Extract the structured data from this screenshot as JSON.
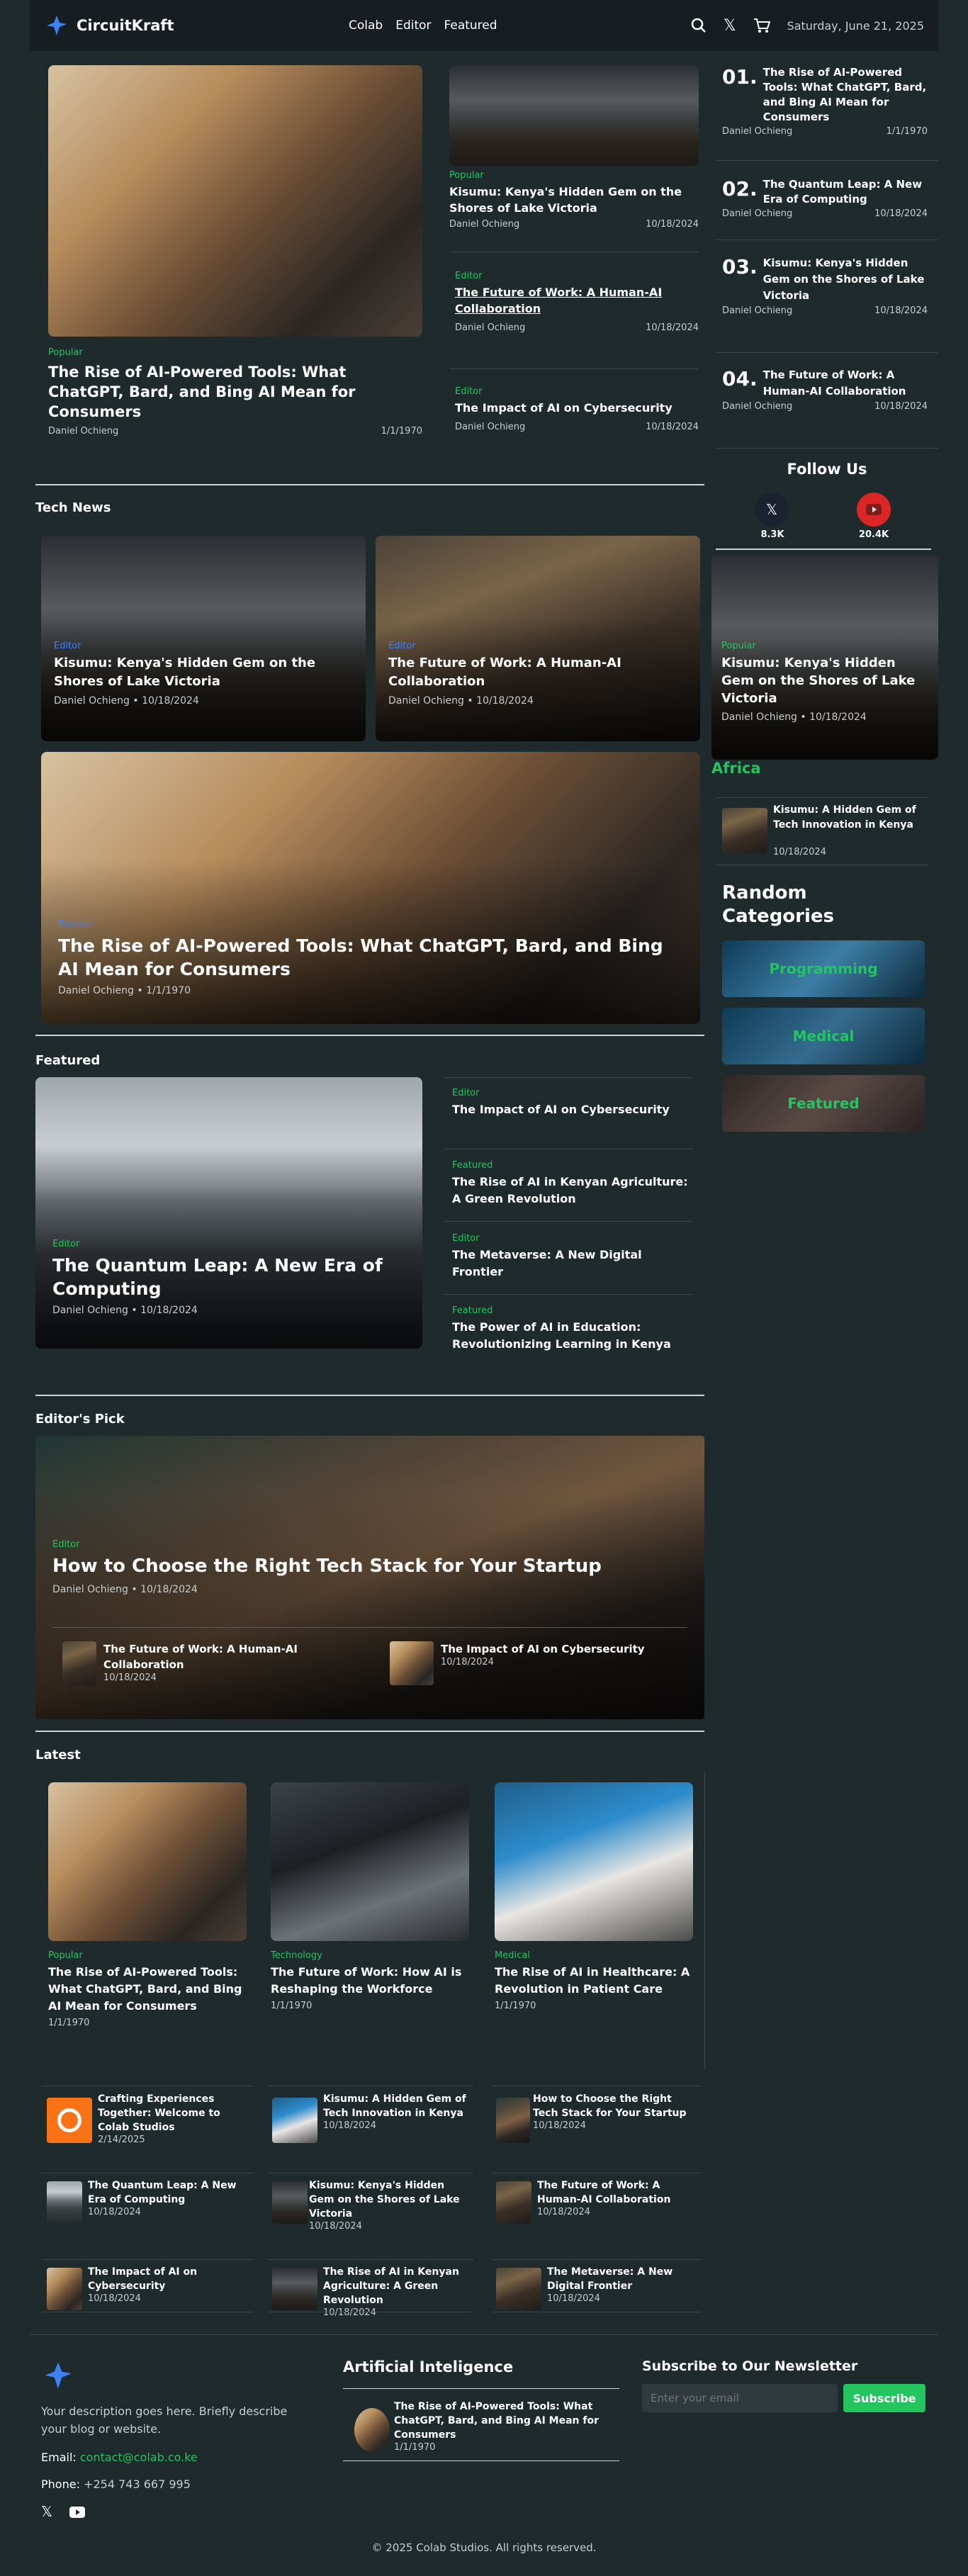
{
  "nav": {
    "brand": "CircuitKraft",
    "links": [
      "Colab",
      "Editor",
      "Featured"
    ],
    "date": "Saturday, June 21, 2025"
  },
  "hero": {
    "main": {
      "category": "Popular",
      "title": "The Rise of AI-Powered Tools: What ChatGPT, Bard, and Bing AI Mean for Consumers",
      "author": "Daniel Ochieng",
      "date": "1/1/1970"
    },
    "mid": [
      {
        "category": "Popular",
        "title": "Kisumu: Kenya's Hidden Gem on the Shores of Lake Victoria",
        "author": "Daniel Ochieng",
        "date": "10/18/2024"
      },
      {
        "category": "Editor",
        "title": "The Future of Work: A Human-AI Collaboration",
        "author": "Daniel Ochieng",
        "date": "10/18/2024"
      },
      {
        "category": "Editor",
        "title": "The Impact of AI on Cybersecurity",
        "author": "Daniel Ochieng",
        "date": "10/18/2024"
      }
    ],
    "ranked": [
      {
        "num": "01.",
        "title": "The Rise of AI-Powered Tools: What ChatGPT, Bard, and Bing AI Mean for Consumers",
        "author": "Daniel Ochieng",
        "date": "1/1/1970"
      },
      {
        "num": "02.",
        "title": "The Quantum Leap: A New Era of Computing",
        "author": "Daniel Ochieng",
        "date": "10/18/2024"
      },
      {
        "num": "03.",
        "title": "Kisumu: Kenya's Hidden Gem on the Shores of Lake Victoria",
        "author": "Daniel Ochieng",
        "date": "10/18/2024"
      },
      {
        "num": "04.",
        "title": "The Future of Work: A Human-AI Collaboration",
        "author": "Daniel Ochieng",
        "date": "10/18/2024"
      }
    ]
  },
  "follow": {
    "title": "Follow Us",
    "x_count": "8.3K",
    "yt_count": "20.4K"
  },
  "tech": {
    "title": "Tech News",
    "cards": [
      {
        "category": "Editor",
        "title": "Kisumu: Kenya's Hidden Gem on the Shores of Lake Victoria",
        "author": "Daniel Ochieng",
        "date": "10/18/2024"
      },
      {
        "category": "Editor",
        "title": "The Future of Work: A Human-AI Collaboration",
        "author": "Daniel Ochieng",
        "date": "10/18/2024"
      }
    ],
    "big": {
      "category": "Popular",
      "title": "The Rise of AI-Powered Tools: What ChatGPT, Bard, and Bing AI Mean for Consumers",
      "author": "Daniel Ochieng",
      "date": "1/1/1970"
    }
  },
  "side_card": {
    "category": "Popular",
    "title": "Kisumu: Kenya's Hidden Gem on the Shores of Lake Victoria",
    "author": "Daniel Ochieng",
    "date": "10/18/2024"
  },
  "africa": {
    "title": "Africa",
    "item": {
      "title": "Kisumu: A Hidden Gem of Tech Innovation in Kenya",
      "date": "10/18/2024"
    }
  },
  "random": {
    "title": "Random Categories",
    "items": [
      "Programming",
      "Medical",
      "Featured"
    ]
  },
  "featured": {
    "title": "Featured",
    "main": {
      "category": "Editor",
      "title": "The Quantum Leap: A New Era of Computing",
      "author": "Daniel Ochieng",
      "date": "10/18/2024"
    },
    "list": [
      {
        "category": "Editor",
        "title": "The Impact of AI on Cybersecurity"
      },
      {
        "category": "Featured",
        "title": "The Rise of AI in Kenyan Agriculture: A Green Revolution"
      },
      {
        "category": "Editor",
        "title": "The Metaverse: A New Digital Frontier"
      },
      {
        "category": "Featured",
        "title": "The Power of AI in Education: Revolutionizing Learning in Kenya"
      }
    ]
  },
  "editors": {
    "title": "Editor's Pick",
    "main": {
      "category": "Editor",
      "title": "How to Choose the Right Tech Stack for Your Startup",
      "author": "Daniel Ochieng",
      "date": "10/18/2024"
    },
    "subs": [
      {
        "title": "The Future of Work: A Human-AI Collaboration",
        "date": "10/18/2024"
      },
      {
        "title": "The Impact of AI on Cybersecurity",
        "date": "10/18/2024"
      }
    ]
  },
  "latest": {
    "title": "Latest",
    "cards": [
      {
        "category": "Popular",
        "title": "The Rise of AI-Powered Tools: What ChatGPT, Bard, and Bing AI Mean for Consumers",
        "date": "1/1/1970"
      },
      {
        "category": "Technology",
        "title": "The Future of Work: How AI is Reshaping the Workforce",
        "date": "1/1/1970"
      },
      {
        "category": "Medical",
        "title": "The Rise of AI in Healthcare: A Revolution in Patient Care",
        "date": "1/1/1970"
      }
    ],
    "grid": [
      {
        "title": "Crafting Experiences Together: Welcome to Colab Studios",
        "date": "2/14/2025"
      },
      {
        "title": "Kisumu: A Hidden Gem of Tech Innovation in Kenya",
        "date": "10/18/2024"
      },
      {
        "title": "How to Choose the Right Tech Stack for Your Startup",
        "date": "10/18/2024"
      },
      {
        "title": "The Quantum Leap: A New Era of Computing",
        "date": "10/18/2024"
      },
      {
        "title": "Kisumu: Kenya's Hidden Gem on the Shores of Lake Victoria",
        "date": "10/18/2024"
      },
      {
        "title": "The Future of Work: A Human-AI Collaboration",
        "date": "10/18/2024"
      },
      {
        "title": "The Impact of AI on Cybersecurity",
        "date": "10/18/2024"
      },
      {
        "title": "The Rise of AI in Kenyan Agriculture: A Green Revolution",
        "date": "10/18/2024"
      },
      {
        "title": "The Metaverse: A New Digital Frontier",
        "date": "10/18/2024"
      }
    ]
  },
  "footer": {
    "description": "Your description goes here. Briefly describe your blog or website.",
    "email_label": "Email:",
    "email": "contact@colab.co.ke",
    "phone_label": "Phone:",
    "phone": "+254 743 667 995",
    "ai_title": "Artificial Inteligence",
    "ai_item": {
      "title": "The Rise of AI-Powered Tools: What ChatGPT, Bard, and Bing AI Mean for Consumers",
      "date": "1/1/1970"
    },
    "news_title": "Subscribe to Our Newsletter",
    "news_placeholder": "Enter your email",
    "news_button": "Subscribe",
    "copyright": "© 2025 Colab Studios. All rights reserved."
  }
}
